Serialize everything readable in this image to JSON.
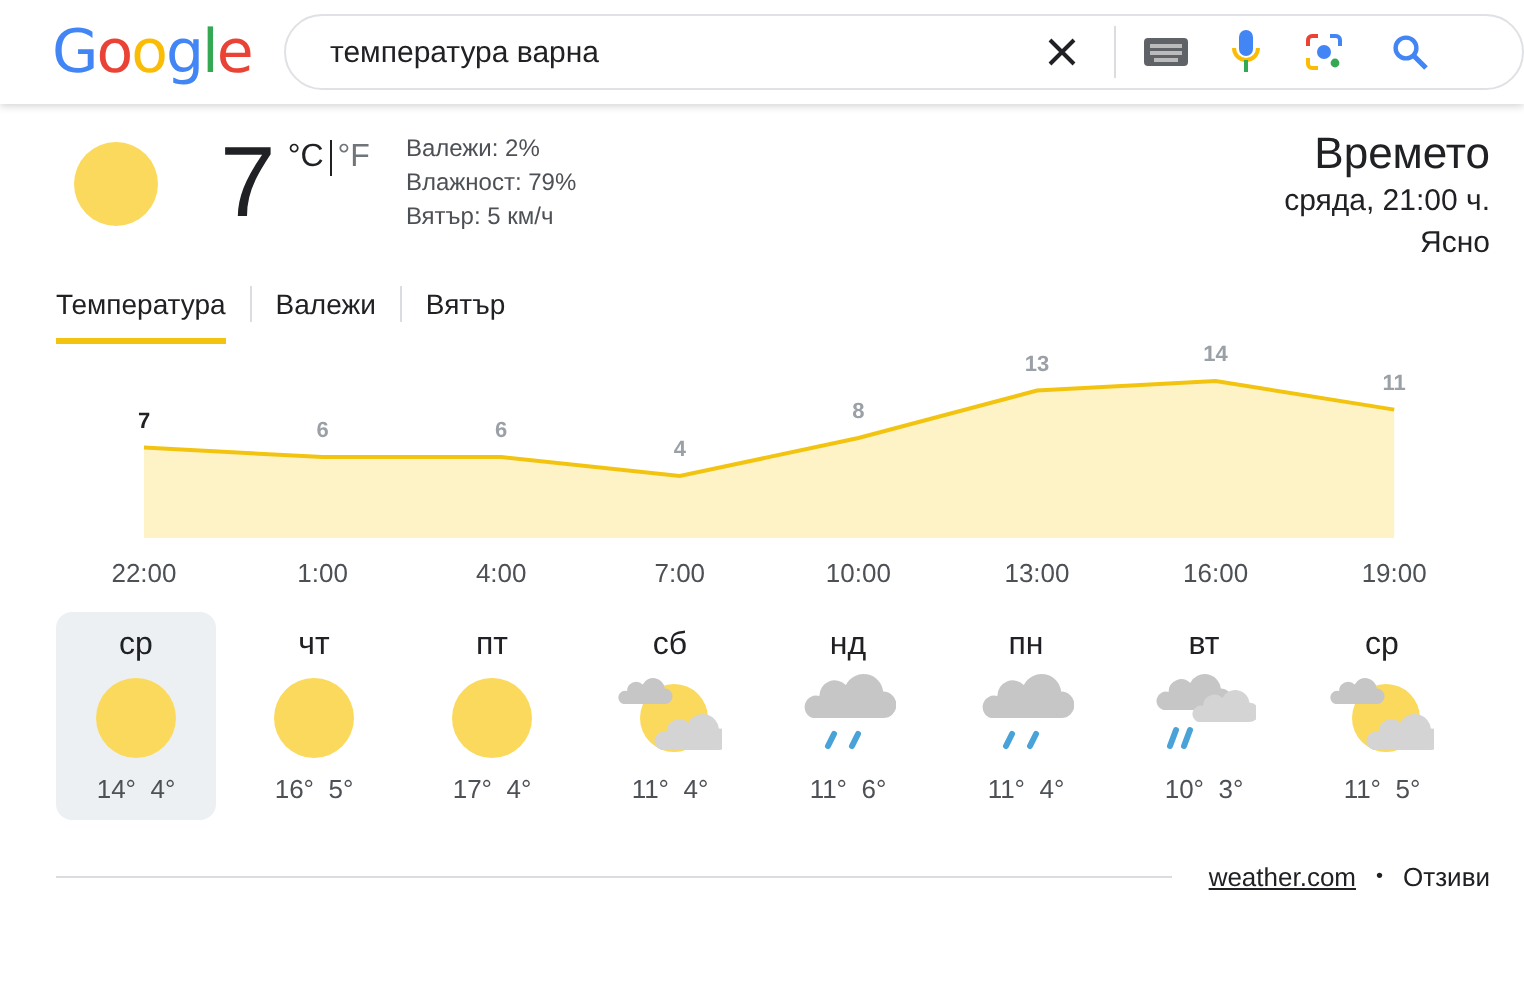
{
  "header": {
    "logo": "Google",
    "query": "температура варна"
  },
  "current": {
    "temperature": "7",
    "units": [
      {
        "label": "°C",
        "selected": true
      },
      {
        "label": "°F",
        "selected": false
      }
    ],
    "details": [
      "Валежи: 2%",
      "Влажност: 79%",
      "Вятър: 5 км/ч"
    ],
    "title": "Времето",
    "datetime": "сряда, 21:00 ч.",
    "condition": "Ясно"
  },
  "tabs": [
    {
      "label": "Температура",
      "selected": true
    },
    {
      "label": "Валежи",
      "selected": false
    },
    {
      "label": "Вятър",
      "selected": false
    }
  ],
  "chart_data": {
    "type": "area",
    "categories": [
      "22:00",
      "1:00",
      "4:00",
      "7:00",
      "10:00",
      "13:00",
      "16:00",
      "19:00"
    ],
    "series": [
      {
        "color": "#f2c40f",
        "values": [
          7,
          6,
          6,
          4,
          8,
          13,
          14,
          11
        ]
      }
    ],
    "data_labels": true
  },
  "days": [
    {
      "day": "ср",
      "kind": "sunny",
      "high": "14°",
      "low": "4°",
      "selected": true
    },
    {
      "day": "чт",
      "kind": "sunny",
      "high": "16°",
      "low": "5°",
      "selected": false
    },
    {
      "day": "пт",
      "kind": "sunny",
      "high": "17°",
      "low": "4°",
      "selected": false
    },
    {
      "day": "сб",
      "kind": "partly_cloudy",
      "high": "11°",
      "low": "4°",
      "selected": false
    },
    {
      "day": "нд",
      "kind": "rain",
      "high": "11°",
      "low": "6°",
      "selected": false
    },
    {
      "day": "пн",
      "kind": "rain",
      "high": "11°",
      "low": "4°",
      "selected": false
    },
    {
      "day": "вт",
      "kind": "showers",
      "high": "10°",
      "low": "3°",
      "selected": false
    },
    {
      "day": "ср",
      "kind": "partly_cloudy",
      "high": "11°",
      "low": "5°",
      "selected": false
    }
  ],
  "footer": {
    "source": "weather.com",
    "separator": "•",
    "feedback": "Отзиви"
  }
}
